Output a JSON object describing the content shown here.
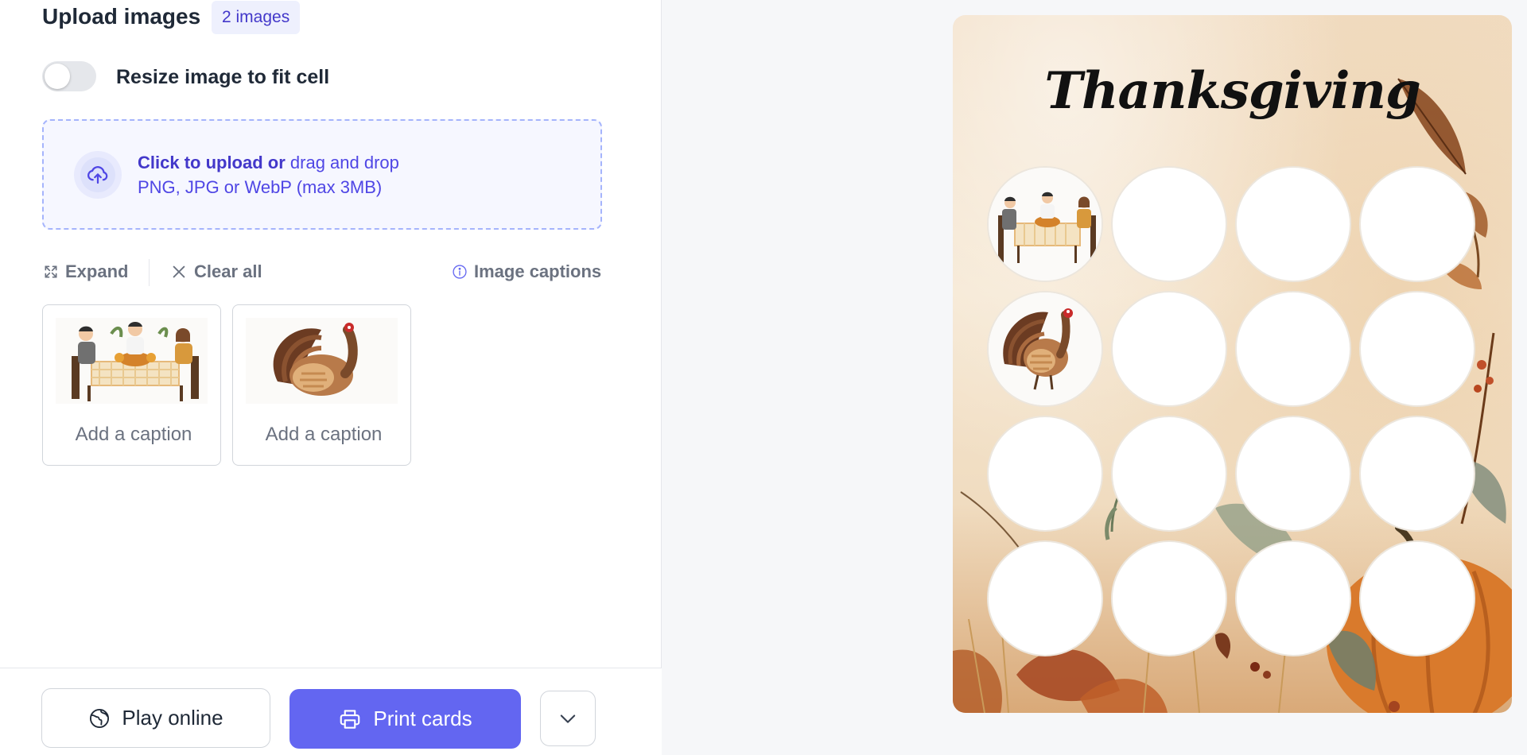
{
  "upload": {
    "title": "Upload images",
    "count_badge": "2 images",
    "resize_label": "Resize image to fit cell",
    "resize_enabled": false,
    "dropzone_click": "Click to upload or",
    "dropzone_drag": " drag and drop",
    "dropzone_formats": "PNG, JPG or WebP (max 3MB)"
  },
  "toolbar": {
    "expand_label": "Expand",
    "clear_label": "Clear all",
    "captions_label": "Image captions"
  },
  "thumbnails": [
    {
      "image": "family-dinner-illustration",
      "caption_placeholder": "Add a caption",
      "caption_value": ""
    },
    {
      "image": "turkey-illustration",
      "caption_placeholder": "Add a caption",
      "caption_value": ""
    }
  ],
  "actions": {
    "play_label": "Play online",
    "print_label": "Print cards",
    "more_icon": "chevron-down-icon"
  },
  "card": {
    "title": "Thanksgiving",
    "rows": 4,
    "columns": 4,
    "filled_cells": [
      "family-dinner-illustration",
      "turkey-illustration"
    ],
    "accent": "#6366f1"
  }
}
